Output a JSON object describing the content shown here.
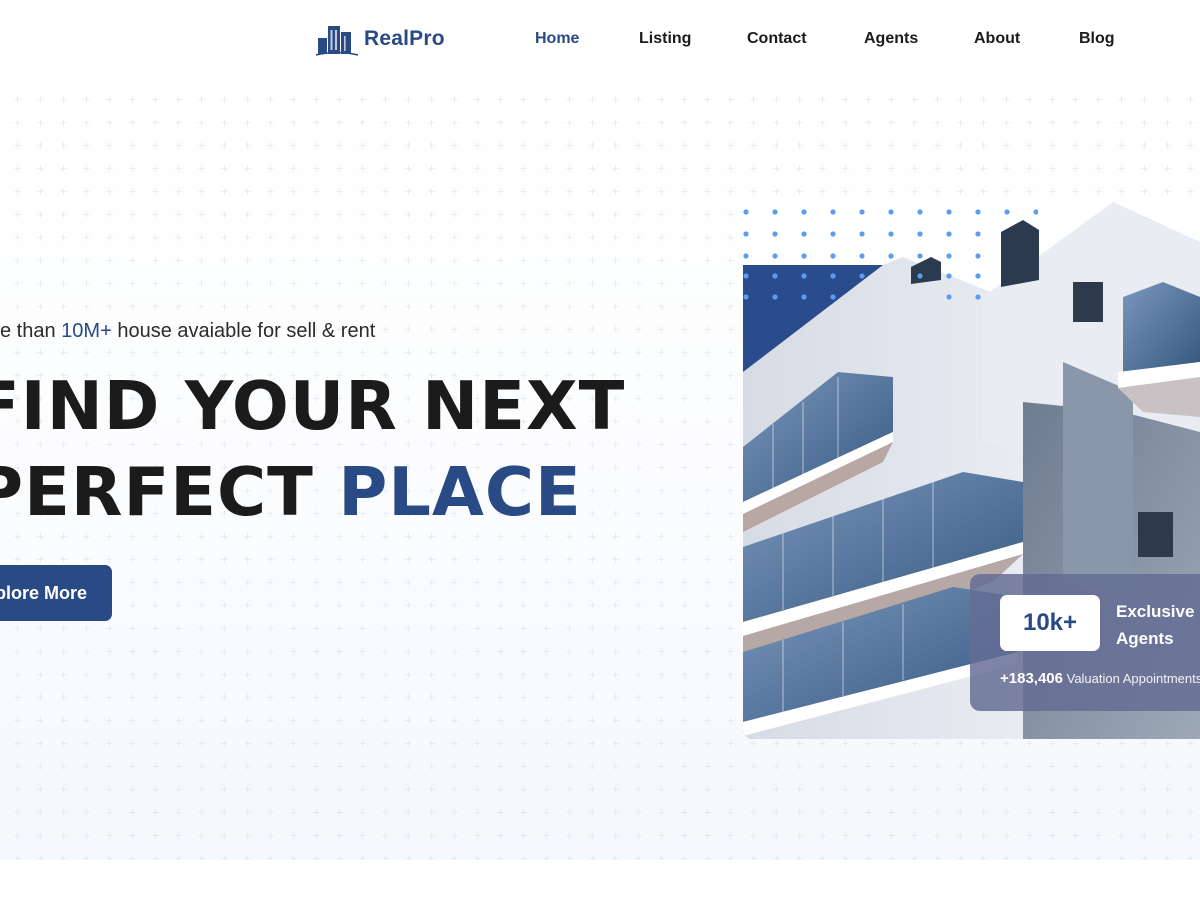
{
  "header": {
    "logo_text": "RealPro",
    "nav": [
      {
        "label": "Home",
        "active": true
      },
      {
        "label": "Listing",
        "active": false
      },
      {
        "label": "Contact",
        "active": false
      },
      {
        "label": "Agents",
        "active": false
      },
      {
        "label": "About",
        "active": false
      },
      {
        "label": "Blog",
        "active": false
      }
    ]
  },
  "hero": {
    "tagline_prefix": "e than ",
    "tagline_highlight": "10M+",
    "tagline_suffix": " house avaiable for sell & rent",
    "headline_line1": "FIND YOUR NEXT",
    "headline_line2_prefix": "PERFECT ",
    "headline_line2_accent": "PLACE",
    "cta_label": "Explore More",
    "image_alt": "modern-apartment-building"
  },
  "stats": {
    "value": "10k+",
    "label": "Exclusive Agents",
    "footer_number": "+183,406",
    "footer_text": "Valuation Appointments"
  },
  "colors": {
    "brand": "#2a4a86",
    "text": "#1b1b1b",
    "dots": "#5b9df0"
  },
  "icons": {
    "logo": "buildings-icon"
  }
}
